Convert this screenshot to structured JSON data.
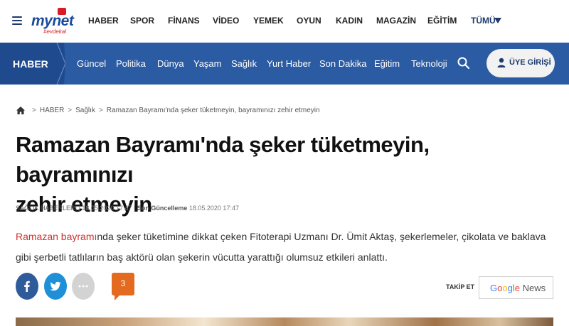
{
  "topbar": {
    "logo_text": "mynet",
    "logo_sub": "#evdekal",
    "nav": [
      "HABER",
      "SPOR",
      "FİNANS",
      "VİDEO",
      "YEMEK",
      "OYUN",
      "KADIN",
      "MAGAZİN",
      "EĞİTİM"
    ],
    "more_label": "TÜMÜ"
  },
  "bluebar": {
    "section": "HABER",
    "items": [
      "Güncel",
      "Politika",
      "Dünya",
      "Yaşam",
      "Sağlık",
      "Yurt Haber",
      "Son Dakika",
      "Eğitim",
      "Teknoloji"
    ],
    "login_label": "ÜYE GİRİŞİ"
  },
  "breadcrumb": [
    "HABER",
    "Sağlık",
    "Ramazan Bayramı'nda şeker tüketmeyin, bayramınızı zehir etmeyin"
  ],
  "article": {
    "title_line1": "Ramazan Bayramı'nda şeker tüketmeyin, bayramınızı",
    "title_line2": "zehir etmeyin",
    "category": "SAĞLIK HABERLERİ",
    "published": "18.05.2020 17:47",
    "updated_label": "Son Güncelleme",
    "updated": "18.05.2020 17:47",
    "summary_link": "Ramazan bayramı",
    "summary_rest": "nda şeker tüketimine dikkat çeken Fitoterapi Uzmanı Dr. Ümit Aktaş, şekerlemeler, çikolata ve baklava gibi şerbetli tatlıların baş aktörü olan şekerin vücutta yarattığı olumsuz etkileri anlattı.",
    "comment_count": "3"
  },
  "follow": {
    "label": "TAKİP ET",
    "gnews_rest": "News"
  },
  "colors": {
    "brand_blue": "#2b5ba3",
    "brand_dark": "#1f4b8e",
    "link_red": "#d0312d",
    "comment_orange": "#e36a1e"
  }
}
